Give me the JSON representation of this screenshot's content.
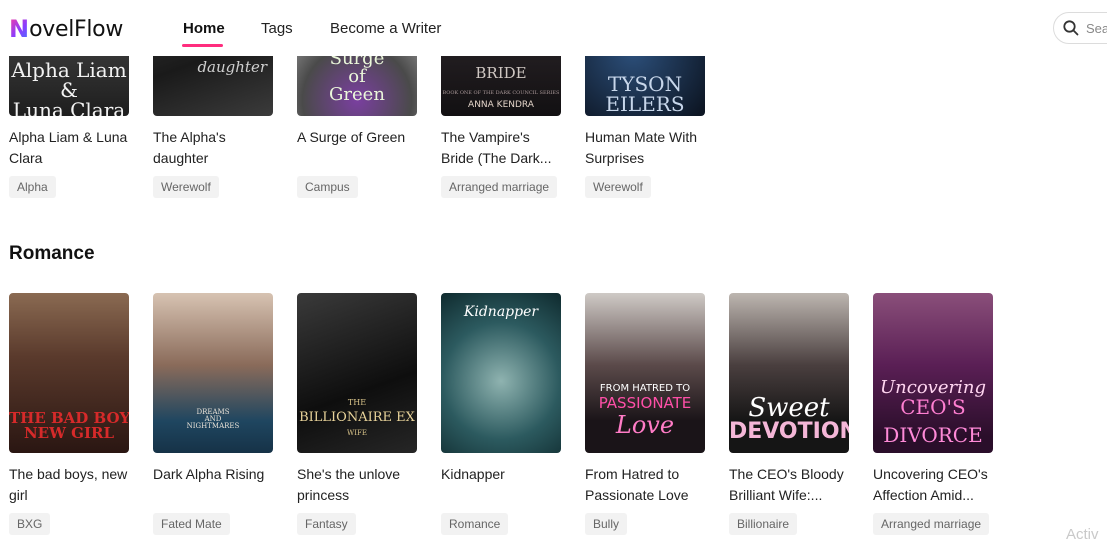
{
  "header": {
    "logo_initial": "N",
    "logo_rest": "ovelFlow",
    "nav": [
      {
        "label": "Home",
        "active": true
      },
      {
        "label": "Tags",
        "active": false
      },
      {
        "label": "Become a Writer",
        "active": false
      }
    ],
    "search_placeholder": "Sear",
    "search_icon": "search-icon",
    "accent_color": "#ff2d7e"
  },
  "top_row": [
    {
      "title": "Alpha Liam & Luna Clara",
      "tag": "Alpha",
      "cover_text": "Alpha Liam & Luna Clara",
      "cover_color": "#3a3a3a"
    },
    {
      "title": "The Alpha's daughter",
      "tag": "Werewolf",
      "cover_text": "daughter",
      "cover_color": "#2b2b2b"
    },
    {
      "title": "A Surge of Green",
      "tag": "Campus",
      "cover_text": "Surge of Green",
      "cover_color": "#cfcfcf"
    },
    {
      "title": "The Vampire's Bride (The Dark...",
      "tag": "Arranged marriage",
      "cover_text": "VAMPIRE'S BRIDE · ANNA KENDRA",
      "cover_color": "#1f1a1c"
    },
    {
      "title": "Human Mate With Surprises",
      "tag": "Werewolf",
      "cover_text": "TYSON EILERS",
      "cover_color": "#14243a"
    }
  ],
  "section": {
    "title": "Romance"
  },
  "romance": [
    {
      "title": "The bad boys, new girl",
      "tag": "BXG",
      "cover_text": "THE BAD BOYS NEW GIRL",
      "cover_color": "#5a2e22"
    },
    {
      "title": "Dark Alpha Rising",
      "tag": "Fated Mate",
      "cover_text": "DREAMS AND NIGHTMARES",
      "cover_color": "#2e5368"
    },
    {
      "title": "She's the unlove princess",
      "tag": "Fantasy",
      "cover_text": "THE BILLIONAIRE EX WIFE",
      "cover_color": "#1c1c1c"
    },
    {
      "title": "Kidnapper",
      "tag": "Romance",
      "cover_text": "Kidnapper",
      "cover_color": "#1f4a4e"
    },
    {
      "title": "From Hatred to Passionate Love",
      "tag": "Bully",
      "cover_text": "FROM HATRED TO PASSIONATE Love",
      "cover_color": "#2a2230"
    },
    {
      "title": "The CEO's Bloody Brilliant Wife:...",
      "tag": "Billionaire",
      "cover_text": "Sweet DEVOTION",
      "cover_color": "#2b2b2b"
    },
    {
      "title": "Uncovering CEO's Affection Amid...",
      "tag": "Arranged marriage",
      "cover_text": "Uncovering CEO'S DIVORCE",
      "cover_color": "#5a1f55"
    }
  ],
  "watermark": "Activ"
}
